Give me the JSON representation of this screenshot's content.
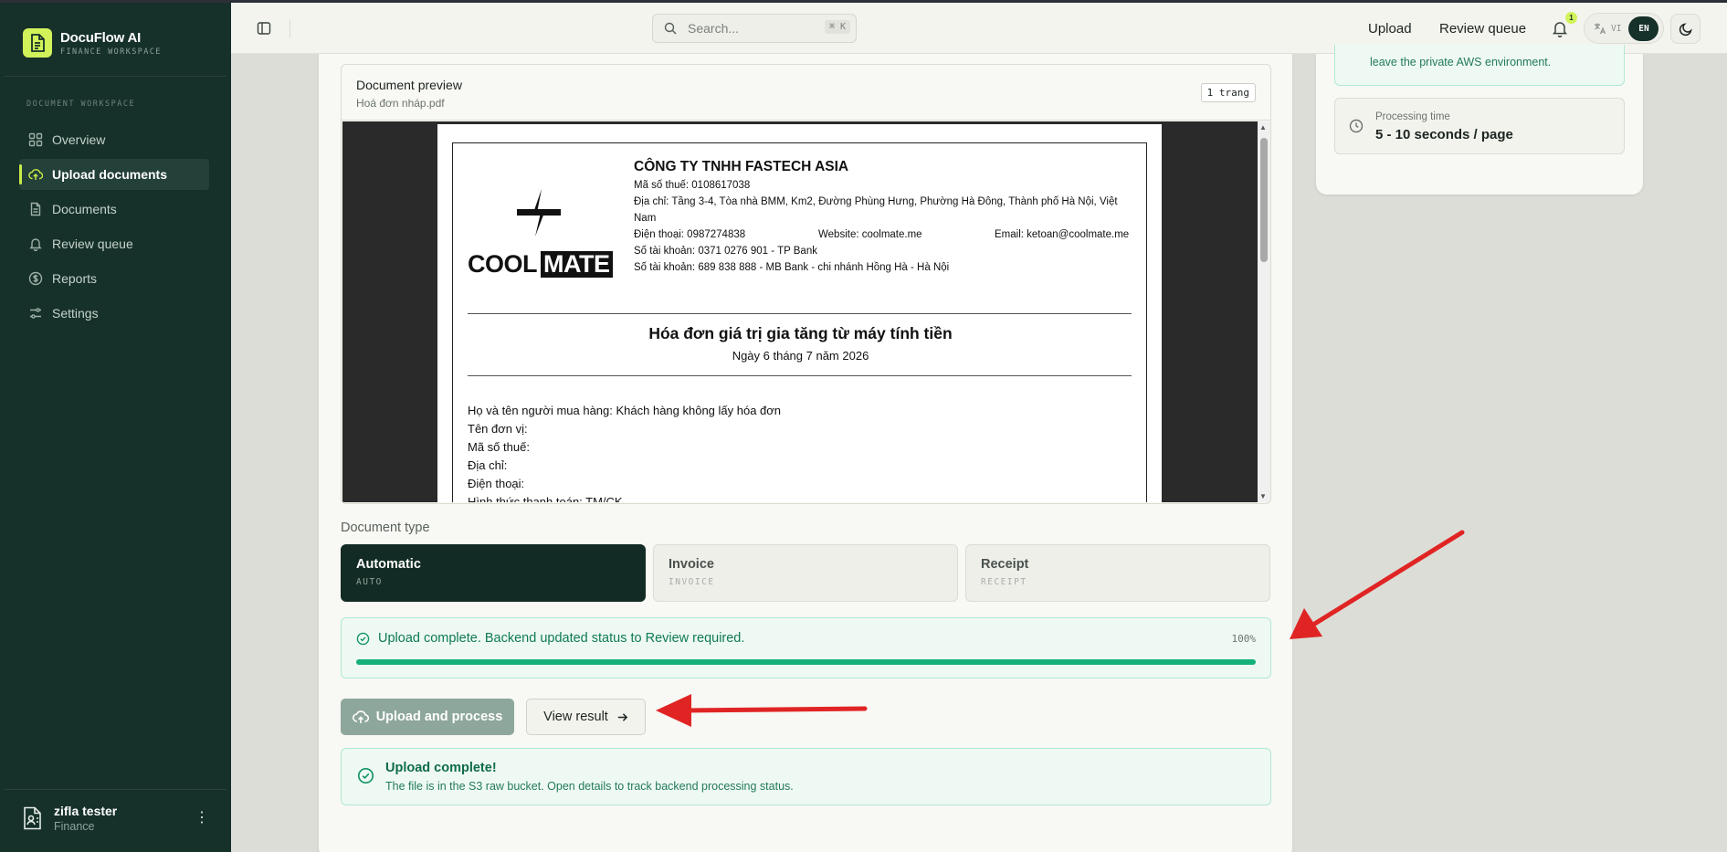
{
  "brand": {
    "name": "DocuFlow AI",
    "subtitle": "FINANCE WORKSPACE"
  },
  "sidebar": {
    "section_label": "DOCUMENT WORKSPACE",
    "items": [
      {
        "label": "Overview",
        "icon": "grid-icon"
      },
      {
        "label": "Upload documents",
        "icon": "cloud-upload-icon",
        "active": true
      },
      {
        "label": "Documents",
        "icon": "file-icon"
      },
      {
        "label": "Review queue",
        "icon": "bell-icon"
      },
      {
        "label": "Reports",
        "icon": "dollar-icon"
      },
      {
        "label": "Settings",
        "icon": "sliders-icon"
      }
    ],
    "user": {
      "name": "zifla tester",
      "role": "Finance"
    }
  },
  "topbar": {
    "search_placeholder": "Search...",
    "search_shortcut": "⌘ K",
    "upload_link": "Upload",
    "review_link": "Review queue",
    "notification_count": "1",
    "lang_vi": "VI",
    "lang_en": "EN"
  },
  "preview": {
    "title": "Document preview",
    "filename": "Hoá đơn nháp.pdf",
    "page_count": "1 trang"
  },
  "invoice": {
    "logo_cool": "COOL",
    "logo_mate": "MATE",
    "company": "CÔNG TY TNHH FASTECH ASIA",
    "tax_code": "Mã số thuế: 0108617038",
    "address_1": "Địa chỉ: Tầng 3-4, Tòa nhà BMM, Km2, Đường Phùng Hưng, Phường Hà Đông, Thành phố Hà Nội, Việt",
    "address_2": "Nam",
    "phone": "Điện thoại: 0987274838",
    "website": "Website: coolmate.me",
    "email": "Email: ketoan@coolmate.me",
    "account_1": "Số tài khoản: 0371 0276 901 - TP Bank",
    "account_2": "Số tài khoản: 689 838 888 - MB Bank - chi nhánh Hồng Hà - Hà Nội",
    "title": "Hóa đơn giá trị gia tăng từ máy tính tiền",
    "date": "Ngày 6 tháng 7 năm 2026",
    "buyer": "Họ và tên người mua hàng: Khách hàng không lấy hóa đơn",
    "unit": "Tên đơn vị:",
    "buyer_tax": "Mã số thuế:",
    "buyer_address": "Địa chỉ:",
    "buyer_phone": "Điện thoại:",
    "payment": "Hình thức thanh toán: TM/CK"
  },
  "document_type": {
    "label": "Document type",
    "options": [
      {
        "label": "Automatic",
        "code": "AUTO",
        "selected": true
      },
      {
        "label": "Invoice",
        "code": "INVOICE"
      },
      {
        "label": "Receipt",
        "code": "RECEIPT"
      }
    ]
  },
  "progress": {
    "message": "Upload complete. Backend updated status to Review required.",
    "percent_label": "100%",
    "percent": 100
  },
  "actions": {
    "upload": "Upload and process",
    "view": "View result"
  },
  "result": {
    "title": "Upload complete!",
    "message": "The file is in the S3 raw bucket. Open details to track backend processing status."
  },
  "right_panel": {
    "env_text": "leave the private AWS environment.",
    "processing_label": "Processing time",
    "processing_value": "5 - 10 seconds / page"
  },
  "colors": {
    "sidebar": "#16302a",
    "accent": "#d2f25a",
    "success": "#14b07a",
    "annotation": "#e02424"
  }
}
